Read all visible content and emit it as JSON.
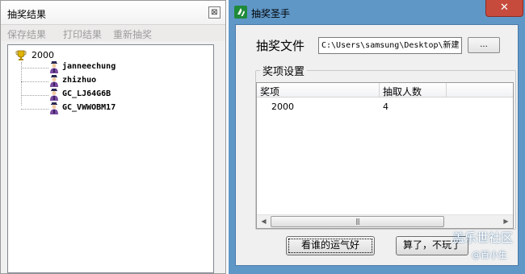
{
  "left_window": {
    "title": "抽奖结果",
    "close_glyph": "⊠",
    "menu": [
      "保存结果",
      "打印结果",
      "重新抽奖"
    ],
    "tree": {
      "root": "2000",
      "winners": [
        "janneechung",
        "zhizhuo",
        "GC_LJ64G6B",
        "GC_VWWOBM17"
      ]
    }
  },
  "right_window": {
    "title": "抽奖圣手",
    "close_glyph": "✕",
    "file_label": "抽奖文件",
    "file_path": "C:\\Users\\samsung\\Desktop\\新建",
    "browse_label": "...",
    "group_title": "奖项设置",
    "columns": [
      "奖项",
      "抽取人数"
    ],
    "rows": [
      {
        "prize": "2000",
        "count": "4"
      }
    ],
    "scroll_left_glyph": "◀",
    "scroll_right_glyph": "▶",
    "scroll_grip": "|||",
    "draw_button": "看谁的运气好",
    "quit_button": "算了，不玩了"
  },
  "watermark": {
    "main": "盖乐世社区",
    "sub": "@百小生"
  },
  "icons": [
    "trophy-icon",
    "user-icon",
    "app-icon"
  ],
  "colors": {
    "title_bar_blue": "#5f97c7",
    "close_red": "#c74b3d",
    "menu_disabled": "#9c9c9c"
  }
}
